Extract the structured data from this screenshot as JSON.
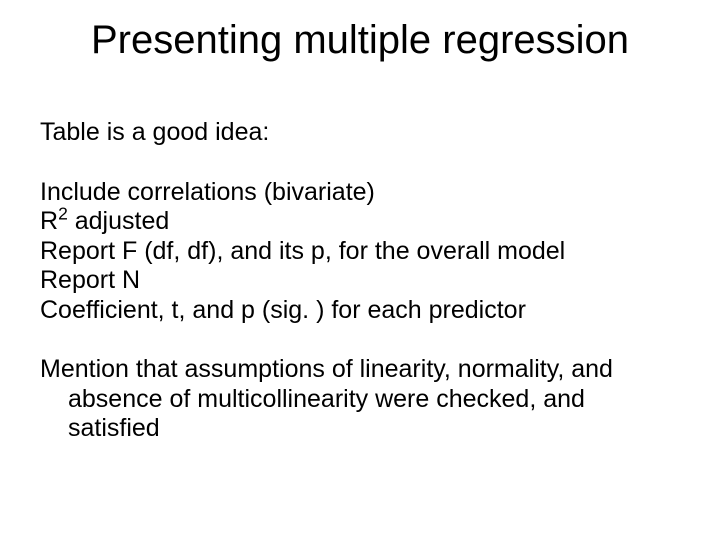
{
  "title": "Presenting multiple regression",
  "intro": "Table is a good idea:",
  "items": {
    "line1": "Include correlations (bivariate)",
    "line2_pre": "R",
    "line2_sup": "2",
    "line2_post": " adjusted",
    "line3": "Report F (df, df), and its p, for the overall model",
    "line4": "Report N",
    "line5": "Coefficient, t, and p (sig. ) for each predictor"
  },
  "closing": "Mention that assumptions of linearity, normality, and absence of multicollinearity were checked, and satisfied"
}
